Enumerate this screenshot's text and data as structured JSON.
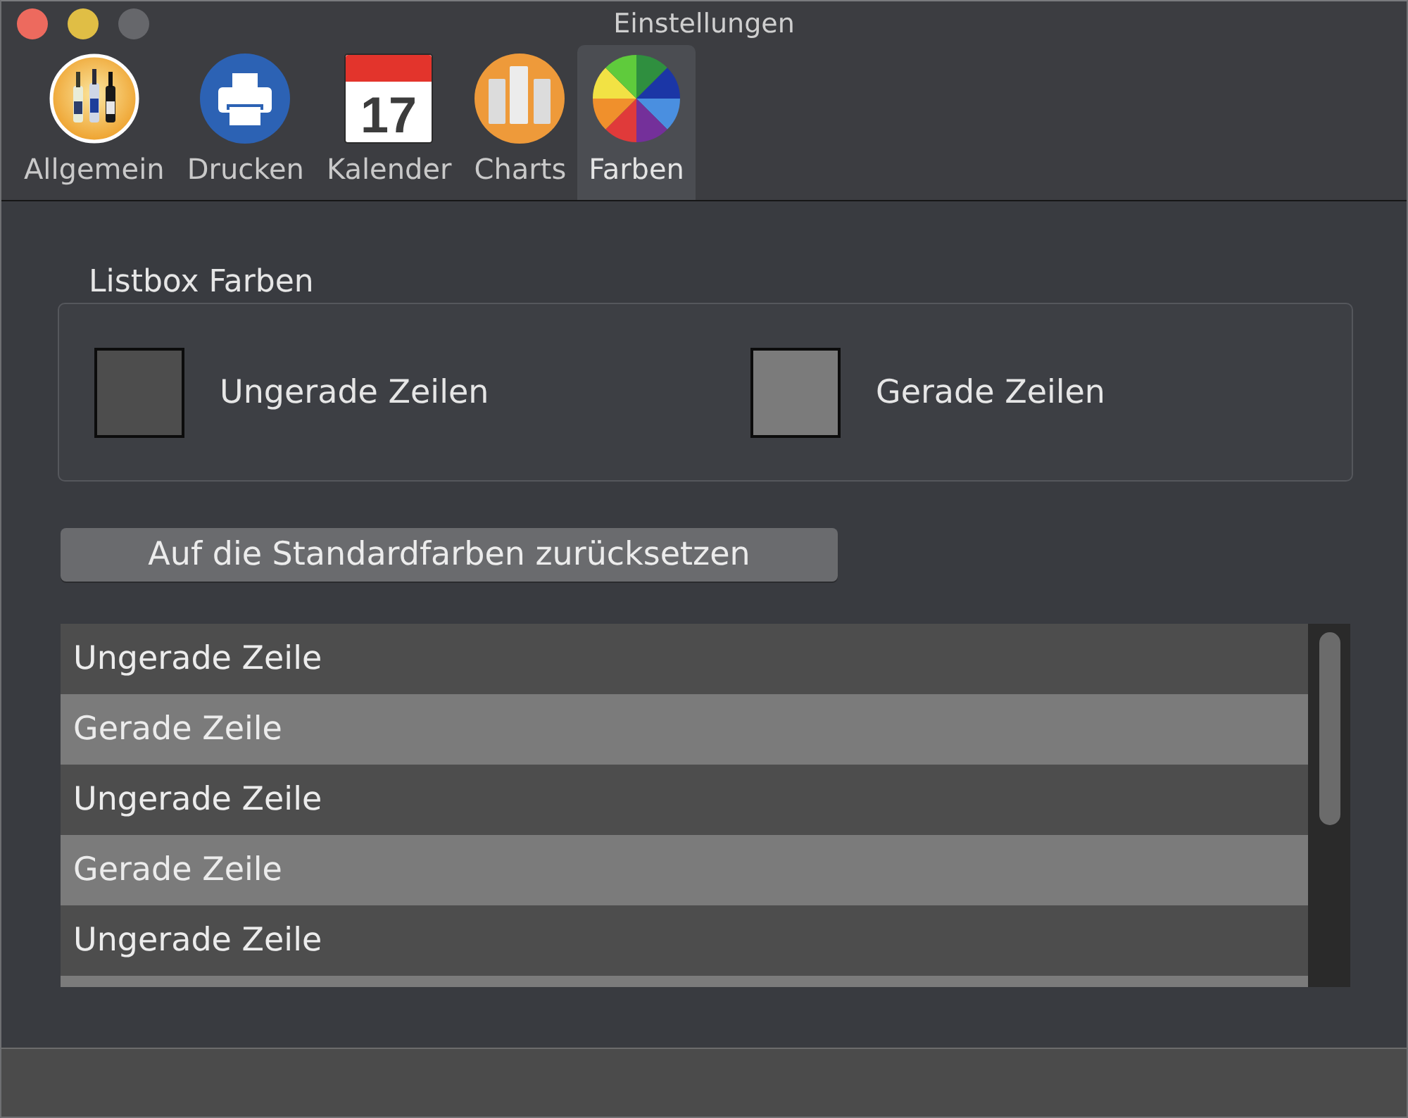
{
  "window": {
    "title": "Einstellungen",
    "zoom_enabled": false
  },
  "toolbar": {
    "items": [
      {
        "label": "Allgemein",
        "kind": "bottles",
        "selected": false
      },
      {
        "label": "Drucken",
        "kind": "printer",
        "selected": false
      },
      {
        "label": "Kalender",
        "kind": "calendar",
        "icon_text": "17",
        "selected": false
      },
      {
        "label": "Charts",
        "kind": "bar-chart",
        "selected": false
      },
      {
        "label": "Farben",
        "kind": "color-wheel",
        "selected": true
      }
    ]
  },
  "listbox_colors": {
    "title": "Listbox Farben",
    "swatches": [
      {
        "label": "Ungerade Zeilen",
        "kind": "odd",
        "color": "#4d4d4d"
      },
      {
        "label": "Gerade Zeilen",
        "kind": "even",
        "color": "#7b7b7b"
      }
    ]
  },
  "reset_button": {
    "label": "Auf die Standardfarben zurücksetzen"
  },
  "preview_list": {
    "rows": [
      {
        "text": "Ungerade Zeile",
        "kind": "odd"
      },
      {
        "text": "Gerade Zeile",
        "kind": "even"
      },
      {
        "text": "Ungerade Zeile",
        "kind": "odd"
      },
      {
        "text": "Gerade Zeile",
        "kind": "even"
      },
      {
        "text": "Ungerade Zeile",
        "kind": "odd"
      },
      {
        "kind": "even"
      }
    ]
  }
}
